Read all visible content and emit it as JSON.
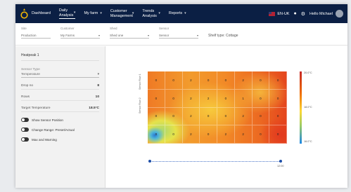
{
  "nav": {
    "items": [
      {
        "label": "Dashboard",
        "caret": false,
        "active": false
      },
      {
        "label": "Daily Analysis",
        "caret": true,
        "active": true
      },
      {
        "label": "My farm",
        "caret": true,
        "active": false
      },
      {
        "label": "Customer Management",
        "caret": true,
        "active": false
      },
      {
        "label": "Trends Analysis",
        "caret": true,
        "active": false
      },
      {
        "label": "Reports",
        "caret": true,
        "active": false
      }
    ],
    "language": "EN-UK",
    "user_name": "Hello Michael"
  },
  "filters": {
    "site": {
      "label": "Site",
      "value": "Production"
    },
    "customer": {
      "label": "Customer",
      "value": "My Farms"
    },
    "shed": {
      "label": "Shed",
      "value": "Shed one"
    },
    "sensor": {
      "label": "Sensor",
      "value": "Sensor"
    },
    "extra": "Shelf type: Cottage"
  },
  "left_panel": {
    "title": "Heatpeak 1",
    "sensor_type_label": "Sensor Type",
    "sensor_type_value": "Temperature",
    "rows": [
      {
        "label": "Drop no",
        "value": "8"
      },
      {
        "label": "Rows",
        "value": "10"
      },
      {
        "label": "Target Temperature",
        "value": "18.5°C"
      }
    ],
    "toggles": [
      "Show Sensor Position",
      "Change Range: Preset/Actual",
      "Max and Warning"
    ]
  },
  "chart_data": {
    "type": "heatmap",
    "rows": 4,
    "cols": 8,
    "row_labels": [
      "Sensor Row 1",
      "Sensor Row 2"
    ],
    "values": [
      [
        "0",
        "0",
        "2",
        "0",
        "0",
        "2",
        "0",
        "0"
      ],
      [
        "0",
        "0",
        "2",
        "2",
        "0",
        "1",
        "0",
        "0"
      ],
      [
        "0",
        "0",
        "2",
        "0",
        "0",
        "2",
        "0",
        "0"
      ],
      [
        "0",
        "0",
        "2",
        "0",
        "2",
        "2",
        "0",
        "0"
      ]
    ],
    "colorbar_labels": [
      "20.0°C",
      "18.0°C",
      "16.0°C"
    ],
    "slider_label": "12:00"
  },
  "colors": {
    "topbar": "#0b1f44",
    "accent": "#1f4fa8"
  }
}
